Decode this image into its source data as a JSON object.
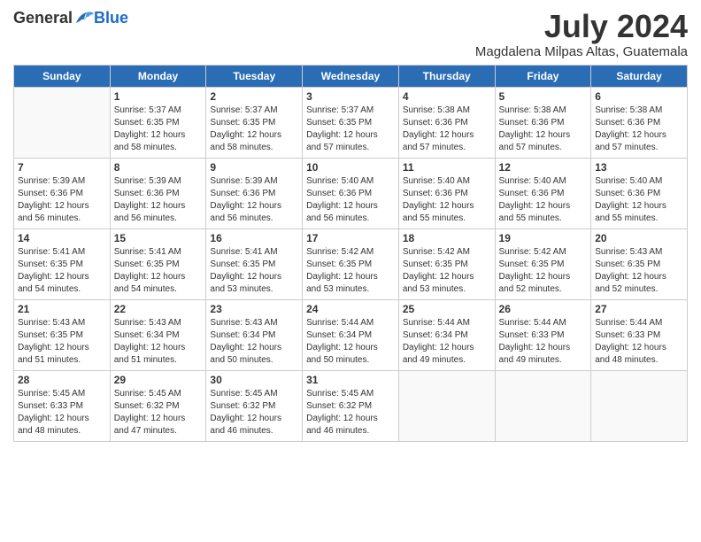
{
  "header": {
    "logo_general": "General",
    "logo_blue": "Blue",
    "month_year": "July 2024",
    "location": "Magdalena Milpas Altas, Guatemala"
  },
  "days_of_week": [
    "Sunday",
    "Monday",
    "Tuesday",
    "Wednesday",
    "Thursday",
    "Friday",
    "Saturday"
  ],
  "weeks": [
    [
      {
        "day": "",
        "info": ""
      },
      {
        "day": "1",
        "info": "Sunrise: 5:37 AM\nSunset: 6:35 PM\nDaylight: 12 hours\nand 58 minutes."
      },
      {
        "day": "2",
        "info": "Sunrise: 5:37 AM\nSunset: 6:35 PM\nDaylight: 12 hours\nand 58 minutes."
      },
      {
        "day": "3",
        "info": "Sunrise: 5:37 AM\nSunset: 6:35 PM\nDaylight: 12 hours\nand 57 minutes."
      },
      {
        "day": "4",
        "info": "Sunrise: 5:38 AM\nSunset: 6:36 PM\nDaylight: 12 hours\nand 57 minutes."
      },
      {
        "day": "5",
        "info": "Sunrise: 5:38 AM\nSunset: 6:36 PM\nDaylight: 12 hours\nand 57 minutes."
      },
      {
        "day": "6",
        "info": "Sunrise: 5:38 AM\nSunset: 6:36 PM\nDaylight: 12 hours\nand 57 minutes."
      }
    ],
    [
      {
        "day": "7",
        "info": "Sunrise: 5:39 AM\nSunset: 6:36 PM\nDaylight: 12 hours\nand 56 minutes."
      },
      {
        "day": "8",
        "info": "Sunrise: 5:39 AM\nSunset: 6:36 PM\nDaylight: 12 hours\nand 56 minutes."
      },
      {
        "day": "9",
        "info": "Sunrise: 5:39 AM\nSunset: 6:36 PM\nDaylight: 12 hours\nand 56 minutes."
      },
      {
        "day": "10",
        "info": "Sunrise: 5:40 AM\nSunset: 6:36 PM\nDaylight: 12 hours\nand 56 minutes."
      },
      {
        "day": "11",
        "info": "Sunrise: 5:40 AM\nSunset: 6:36 PM\nDaylight: 12 hours\nand 55 minutes."
      },
      {
        "day": "12",
        "info": "Sunrise: 5:40 AM\nSunset: 6:36 PM\nDaylight: 12 hours\nand 55 minutes."
      },
      {
        "day": "13",
        "info": "Sunrise: 5:40 AM\nSunset: 6:36 PM\nDaylight: 12 hours\nand 55 minutes."
      }
    ],
    [
      {
        "day": "14",
        "info": "Sunrise: 5:41 AM\nSunset: 6:35 PM\nDaylight: 12 hours\nand 54 minutes."
      },
      {
        "day": "15",
        "info": "Sunrise: 5:41 AM\nSunset: 6:35 PM\nDaylight: 12 hours\nand 54 minutes."
      },
      {
        "day": "16",
        "info": "Sunrise: 5:41 AM\nSunset: 6:35 PM\nDaylight: 12 hours\nand 53 minutes."
      },
      {
        "day": "17",
        "info": "Sunrise: 5:42 AM\nSunset: 6:35 PM\nDaylight: 12 hours\nand 53 minutes."
      },
      {
        "day": "18",
        "info": "Sunrise: 5:42 AM\nSunset: 6:35 PM\nDaylight: 12 hours\nand 53 minutes."
      },
      {
        "day": "19",
        "info": "Sunrise: 5:42 AM\nSunset: 6:35 PM\nDaylight: 12 hours\nand 52 minutes."
      },
      {
        "day": "20",
        "info": "Sunrise: 5:43 AM\nSunset: 6:35 PM\nDaylight: 12 hours\nand 52 minutes."
      }
    ],
    [
      {
        "day": "21",
        "info": "Sunrise: 5:43 AM\nSunset: 6:35 PM\nDaylight: 12 hours\nand 51 minutes."
      },
      {
        "day": "22",
        "info": "Sunrise: 5:43 AM\nSunset: 6:34 PM\nDaylight: 12 hours\nand 51 minutes."
      },
      {
        "day": "23",
        "info": "Sunrise: 5:43 AM\nSunset: 6:34 PM\nDaylight: 12 hours\nand 50 minutes."
      },
      {
        "day": "24",
        "info": "Sunrise: 5:44 AM\nSunset: 6:34 PM\nDaylight: 12 hours\nand 50 minutes."
      },
      {
        "day": "25",
        "info": "Sunrise: 5:44 AM\nSunset: 6:34 PM\nDaylight: 12 hours\nand 49 minutes."
      },
      {
        "day": "26",
        "info": "Sunrise: 5:44 AM\nSunset: 6:33 PM\nDaylight: 12 hours\nand 49 minutes."
      },
      {
        "day": "27",
        "info": "Sunrise: 5:44 AM\nSunset: 6:33 PM\nDaylight: 12 hours\nand 48 minutes."
      }
    ],
    [
      {
        "day": "28",
        "info": "Sunrise: 5:45 AM\nSunset: 6:33 PM\nDaylight: 12 hours\nand 48 minutes."
      },
      {
        "day": "29",
        "info": "Sunrise: 5:45 AM\nSunset: 6:32 PM\nDaylight: 12 hours\nand 47 minutes."
      },
      {
        "day": "30",
        "info": "Sunrise: 5:45 AM\nSunset: 6:32 PM\nDaylight: 12 hours\nand 46 minutes."
      },
      {
        "day": "31",
        "info": "Sunrise: 5:45 AM\nSunset: 6:32 PM\nDaylight: 12 hours\nand 46 minutes."
      },
      {
        "day": "",
        "info": ""
      },
      {
        "day": "",
        "info": ""
      },
      {
        "day": "",
        "info": ""
      }
    ]
  ]
}
